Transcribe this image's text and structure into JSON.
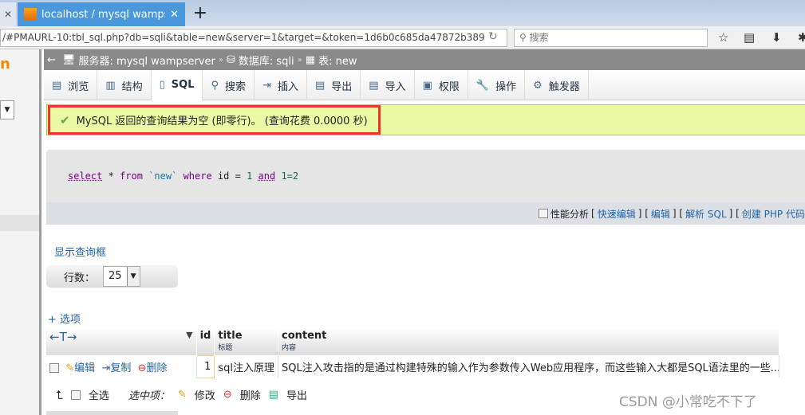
{
  "browser": {
    "tab_title": "localhost / mysql wampser",
    "favicon": "PMA",
    "url": "/#PMAURL-10:tbl_sql.php?db=sqli&table=new&server=1&target=&token=1d6b0c685da47872b389",
    "search_placeholder": "搜索"
  },
  "breadcrumb": {
    "server": "服务器: mysql wampserver",
    "database": "数据库: sqli",
    "table": "表: new"
  },
  "tabs": [
    {
      "label": "浏览",
      "icon": "browse-icon"
    },
    {
      "label": "结构",
      "icon": "structure-icon"
    },
    {
      "label": "SQL",
      "icon": "sql-icon"
    },
    {
      "label": "搜索",
      "icon": "search-icon"
    },
    {
      "label": "插入",
      "icon": "insert-icon"
    },
    {
      "label": "导出",
      "icon": "export-icon"
    },
    {
      "label": "导入",
      "icon": "import-icon"
    },
    {
      "label": "权限",
      "icon": "privileges-icon"
    },
    {
      "label": "操作",
      "icon": "operations-icon"
    },
    {
      "label": "触发器",
      "icon": "triggers-icon"
    }
  ],
  "message": "MySQL 返回的查询结果为空 (即零行)。 (查询花费 0.0000 秒)",
  "sql": {
    "t1": "select",
    "t2": "*",
    "t3": "from",
    "t4": "`new`",
    "t5": "where",
    "t6": "id =",
    "t7": "1",
    "t8": "and",
    "t9": "1=2"
  },
  "sql_actions": {
    "profiling": "性能分析",
    "inline_edit": "快速编辑",
    "edit": "编辑",
    "explain": "解析 SQL",
    "php": "创建 PHP 代码"
  },
  "show_query": "显示查询框",
  "rows": {
    "label": "行数：",
    "value": "25"
  },
  "options": "+ 选项",
  "table": {
    "columns": [
      {
        "name": "id",
        "comment": ""
      },
      {
        "name": "title",
        "comment": "标题"
      },
      {
        "name": "content",
        "comment": "内容"
      }
    ],
    "row_actions": {
      "edit": "编辑",
      "copy": "复制",
      "delete": "删除"
    },
    "rows": [
      {
        "id": "1",
        "title": "sql注入原理",
        "content": "SQL注入攻击指的是通过构建特殊的输入作为参数传入Web应用程序，而这些输入大都是SQL语法里的一些..."
      }
    ]
  },
  "footer": {
    "select_all": "全选",
    "with_selected": "选中项：",
    "change": "修改",
    "delete": "删除",
    "export": "导出"
  },
  "watermark": "CSDN @小常吃不下了",
  "colors": {
    "success_bg": "#ebf8a4",
    "highlight_border": "#ee3333",
    "link": "#2364a4"
  }
}
